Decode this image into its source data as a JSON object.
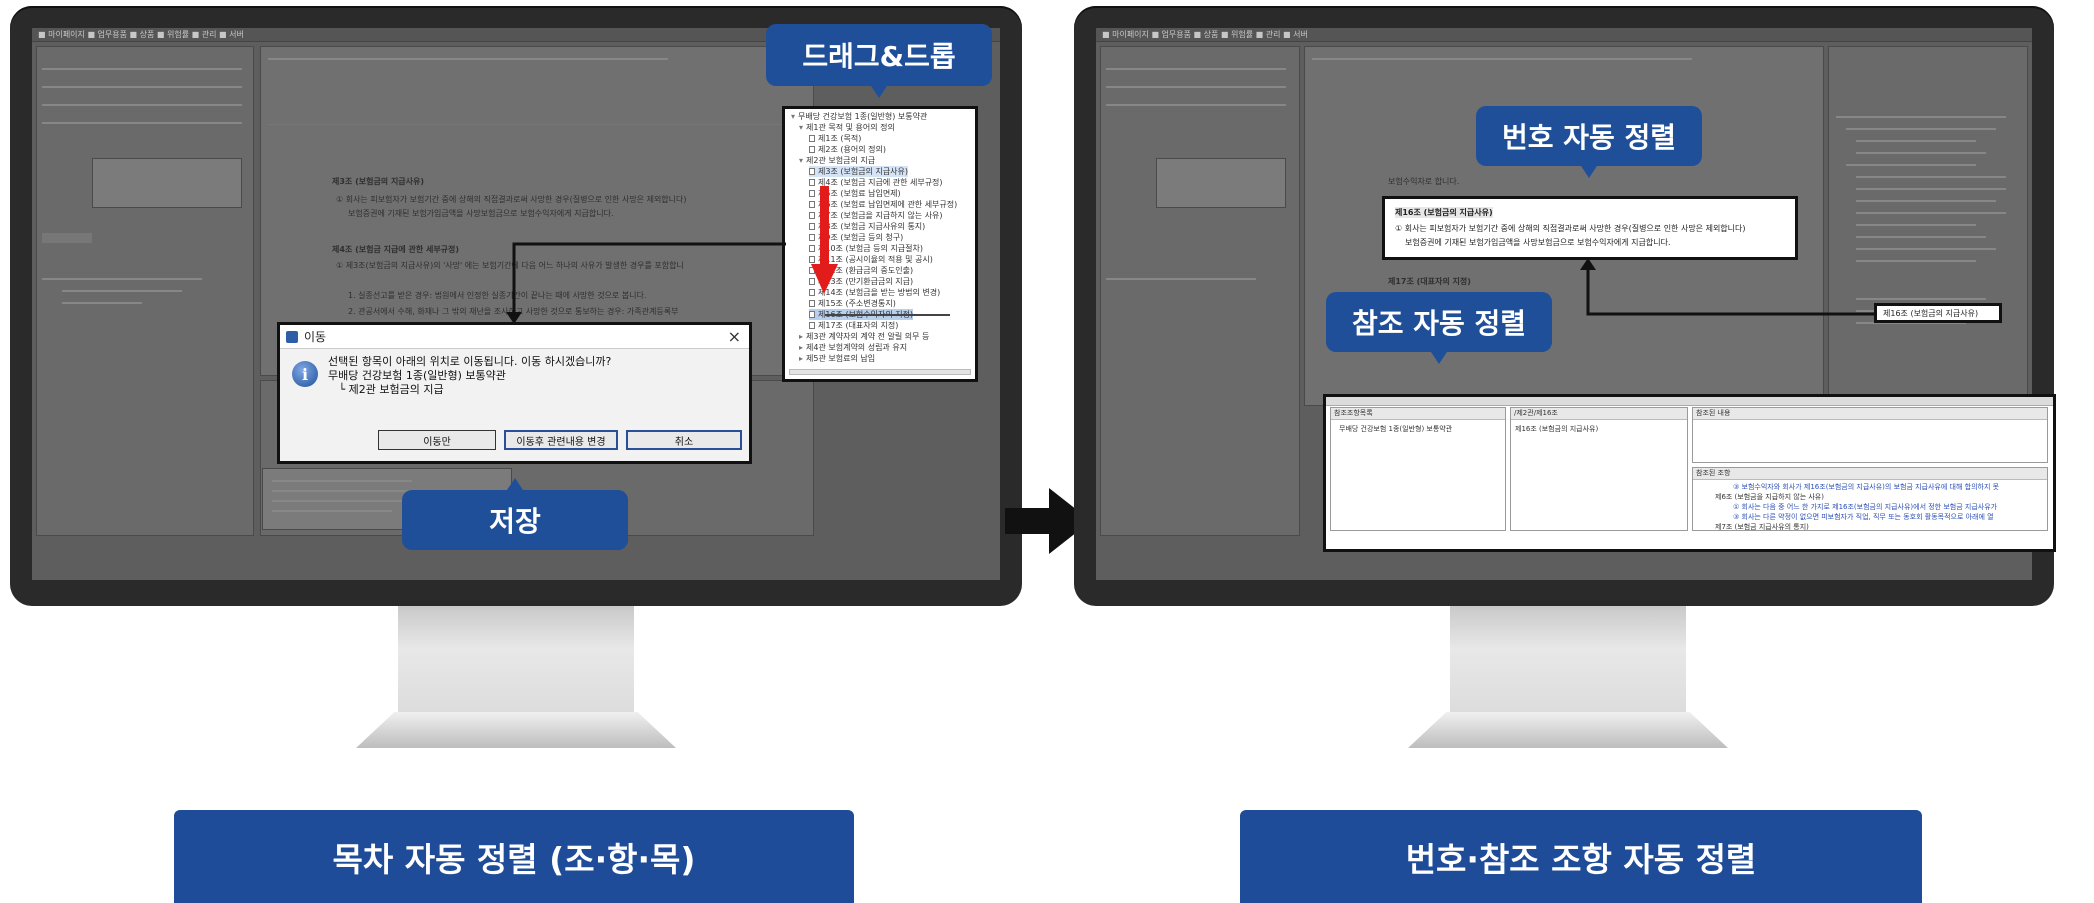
{
  "callouts": {
    "drag_drop": "드래그&드롭",
    "save": "저장",
    "number_sort": "번호 자동 정렬",
    "reference_sort": "참조 자동 정렬"
  },
  "banners": {
    "left": "목차 자동 정렬 (조·항·목)",
    "right": "번호·참조 조항 자동 정렬"
  },
  "dialog": {
    "title": "이동",
    "close": "×",
    "info": "i",
    "message": "선택된 항목이 아래의 위치로 이동됩니다. 이동 하시겠습니까?\n무배당 건강보험 1종(일반형) 보통약관\n   └ 제2관 보험금의 지급",
    "buttons": [
      "이동만",
      "이동후 관련내용 변경",
      "취소"
    ]
  },
  "left_tree": {
    "rows": [
      "무배당 건강보험 1종(일반형) 보통약관",
      "제1관 목적 및 용어의 정의",
      "제1조 (목적)",
      "제2조 (용어의 정의)",
      "제2관 보험금의 지급",
      "제3조 (보험금의 지급사유)",
      "제4조 (보험금 지급에 관한 세부규정)",
      "제5조 (보험료 납입면제)",
      "제6조 (보험료 납입면제에 관한 세부규정)",
      "제7조 (보험금을 지급하지 않는 사유)",
      "제8조 (보험금 지급사유의 통지)",
      "제9조 (보험금 등의 청구)",
      "제10조 (보험금 등의 지급절차)",
      "제11조 (공시이율의 적용 및 공시)",
      "제12조 (환급금의 중도인출)",
      "제13조 (만기환급금의 지급)",
      "제14조 (보험금을 받는 방법의 변경)",
      "제15조 (주소변경통지)",
      "제16조 (보험수익자의 지정)",
      "제17조 (대표자의 지정)",
      "제3관 계약자의 계약 전 알릴 의무 등",
      "제4관 보험계약의 성립과 유지",
      "제5관 보험료의 납입"
    ]
  },
  "left_doc": {
    "heading1": "제3조 (보험금의 지급사유)",
    "para1": "① 회사는 피보험자가 보험기간 중에 상해의 직접결과로써 사망한 경우(질병으로 인한 사망은 제외합니다)",
    "para1b": "보험증권에 기재된 보험가입금액을 사망보험금으로 보험수익자에게 지급합니다.",
    "heading2": "제4조 (보험금 지급에 관한 세부규정)",
    "para2": "① 제3조(보험금의 지급사유)의 '사망' 에는 보험기간에 다음 어느 하나의 사유가 발생한 경우를 포함합니",
    "para3": "1. 실종선고를 받은 경우: 법원에서 인정한 실종기간이 끝나는 때에 사망한 것으로 봅니다.",
    "para4": "2. 관공서에서 수해, 화재나 그 밖의 재난을 조사하고 사망한 것으로 통보하는 경우: 가족관계등록부"
  },
  "right_doc": {
    "heading": "제16조 (보험금의 지급사유)",
    "para1": "① 회사는 피보험자가 보험기간 중에 상해의 직접결과로써 사망한 경우(질병으로 인한 사망은 제외합니다)",
    "para2": "보험증권에 기재된 보험가입금액을 사망보험금으로 보험수익자에게 지급합니다.",
    "tree_item": "제16조 (보험금의 지급사유)",
    "above_text": "보험수익자로 합니다.",
    "below_text": "제17조 (대표자의 지정)"
  },
  "ref_panel": {
    "left_head": "참조조항목록",
    "left_item": "무배당 건강보험 1종(일반형) 보통약관",
    "mid_head": "/제2관/제16조",
    "mid_item": "제16조 (보험금의 지급사유)",
    "right_head": "참조된 내용",
    "right_head2": "참조된 조항",
    "ref_lines": [
      "③ 보험수익자와 회사가 제16조(보험금의 지급사유)의 보험금 지급사유에 대해 합의하지 못",
      "제6조 (보험금을 지급하지 않는 사유)",
      "① 회사는 다음 중 어느 한 가지로 제16조(보험금의 지급사유)에서 정한 보험금 지급사유가",
      "③ 회사는 다른 약정이 없으면 피보험자가 직업, 직무 또는 동호회 활동목적으로 아래에 열",
      "제7조 (보험금 지급사유의 통지)"
    ]
  },
  "colors": {
    "banner_blue": "#1e4c98",
    "callout_blue": "#1f4f99",
    "red_arrow": "#e21b1b"
  }
}
